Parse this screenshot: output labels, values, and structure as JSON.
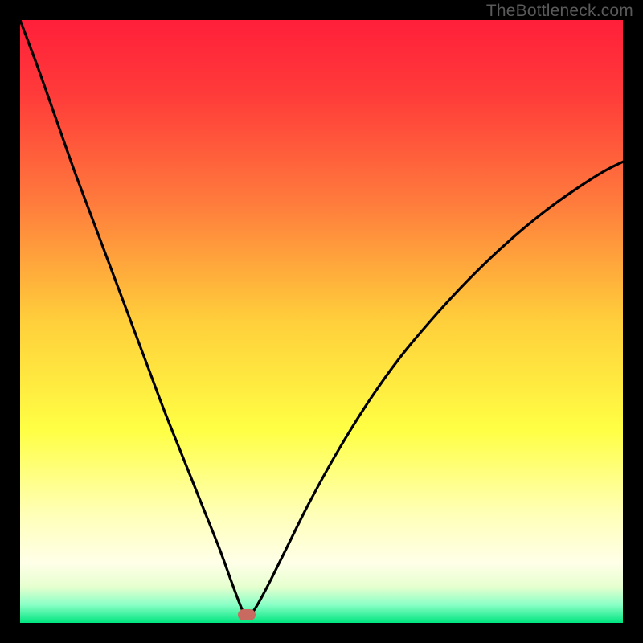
{
  "watermark": "TheBottleneck.com",
  "chart_data": {
    "type": "line",
    "title": "",
    "xlabel": "",
    "ylabel": "",
    "xlim": [
      0,
      100
    ],
    "ylim": [
      0,
      100
    ],
    "gradient_stops": [
      {
        "pct": 0,
        "color": "#ff1f3a"
      },
      {
        "pct": 12,
        "color": "#ff3a3a"
      },
      {
        "pct": 30,
        "color": "#ff7a3c"
      },
      {
        "pct": 50,
        "color": "#ffcf3b"
      },
      {
        "pct": 68,
        "color": "#ffff44"
      },
      {
        "pct": 82,
        "color": "#ffffb8"
      },
      {
        "pct": 90,
        "color": "#ffffe8"
      },
      {
        "pct": 94,
        "color": "#e6ffcf"
      },
      {
        "pct": 97,
        "color": "#8affc6"
      },
      {
        "pct": 100,
        "color": "#00e580"
      }
    ],
    "series": [
      {
        "name": "bottleneck-curve",
        "x": [
          0.0,
          3.0,
          6.0,
          9.0,
          12.0,
          15.0,
          18.0,
          21.0,
          24.0,
          27.0,
          30.0,
          33.0,
          35.0,
          36.5,
          37.3,
          38.0,
          39.0,
          41.0,
          44.0,
          48.0,
          53.0,
          58.0,
          63.0,
          68.0,
          73.0,
          78.0,
          83.0,
          88.0,
          93.0,
          97.0,
          100.0
        ],
        "values": [
          100.0,
          92.0,
          83.5,
          75.0,
          67.0,
          59.0,
          51.0,
          43.0,
          35.0,
          27.5,
          20.0,
          12.5,
          7.0,
          3.0,
          1.3,
          1.3,
          2.4,
          6.0,
          12.0,
          20.0,
          29.0,
          37.0,
          44.0,
          50.0,
          55.5,
          60.5,
          65.0,
          69.0,
          72.5,
          75.0,
          76.5
        ]
      }
    ],
    "marker": {
      "x": 37.6,
      "y": 1.4,
      "color": "#c86a5f"
    }
  }
}
